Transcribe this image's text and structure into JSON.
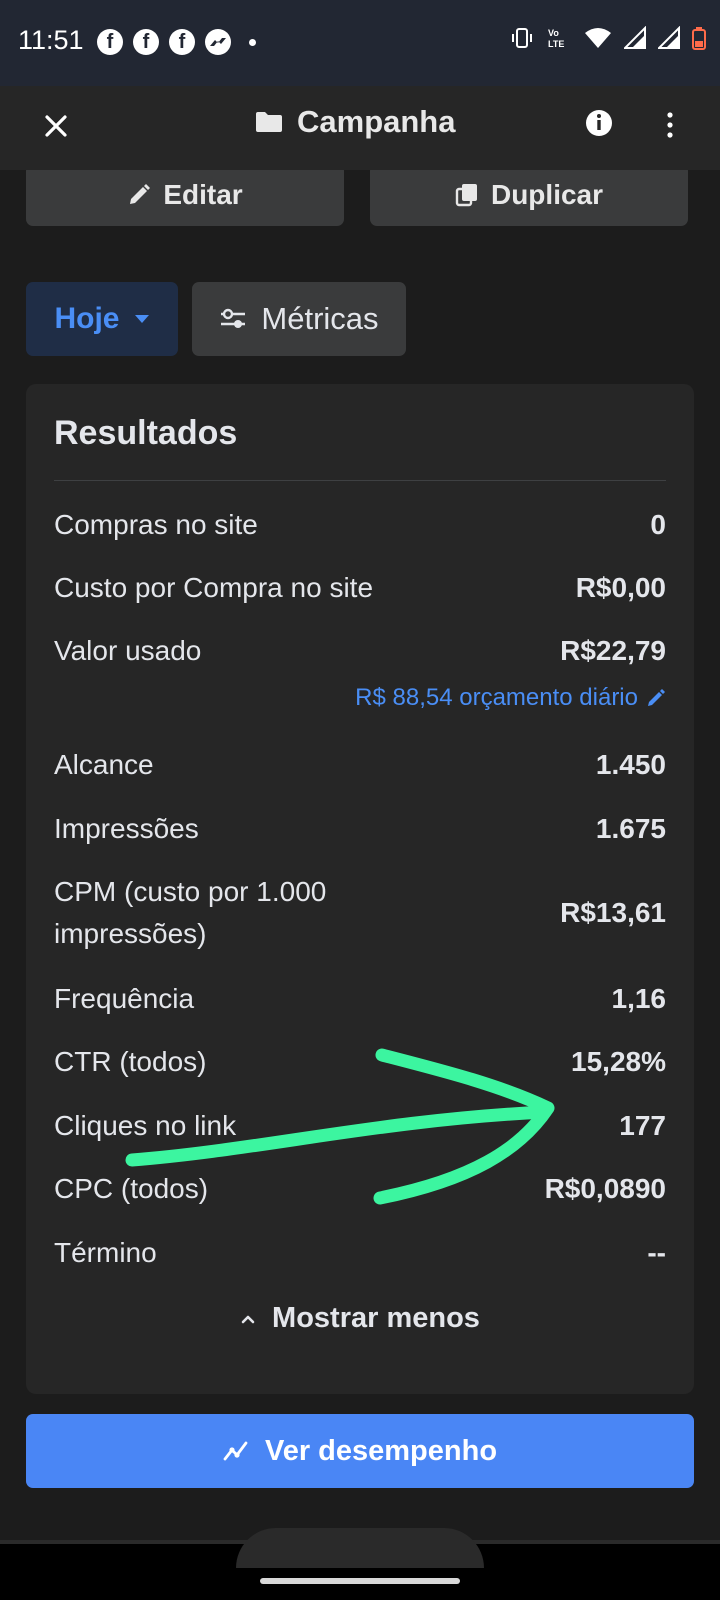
{
  "status_bar": {
    "time": "11:51",
    "notification_icons": [
      "facebook-icon",
      "facebook-icon",
      "facebook-icon",
      "messenger-icon"
    ],
    "system_icons": [
      "vibrate-icon",
      "volte-icon",
      "wifi-icon",
      "signal-icon",
      "signal-icon",
      "battery-low-icon"
    ],
    "volte_text": "Vo LTE"
  },
  "app_bar": {
    "title": "Campanha",
    "icons": [
      "close-icon",
      "folder-icon",
      "info-icon",
      "more-vertical-icon"
    ]
  },
  "actions": {
    "edit_label": "Editar",
    "duplicate_label": "Duplicar"
  },
  "filters": {
    "date_label": "Hoje",
    "metrics_label": "Métricas"
  },
  "results": {
    "title": "Resultados",
    "rows": [
      {
        "label": "Compras no site",
        "value": "0"
      },
      {
        "label": "Custo por Compra no site",
        "value": "R$0,00"
      },
      {
        "label": "Valor usado",
        "value": "R$22,79"
      },
      {
        "label": "Alcance",
        "value": "1.450"
      },
      {
        "label": "Impressões",
        "value": "1.675"
      },
      {
        "label": "CPM (custo por 1.000 impressões)",
        "value": "R$13,61"
      },
      {
        "label": "Frequência",
        "value": "1,16"
      },
      {
        "label": "CTR (todos)",
        "value": "15,28%"
      },
      {
        "label": "Cliques no link",
        "value": "177"
      },
      {
        "label": "CPC (todos)",
        "value": "R$0,0890"
      },
      {
        "label": "Término",
        "value": "--"
      }
    ],
    "budget_link": "R$ 88,54 orçamento diário",
    "show_less_label": "Mostrar menos"
  },
  "performance_button": {
    "label": "Ver desempenho"
  },
  "colors": {
    "accent_blue": "#4a86f5",
    "link_blue": "#4a8ef5",
    "annotation_green": "#3cf5a0"
  }
}
